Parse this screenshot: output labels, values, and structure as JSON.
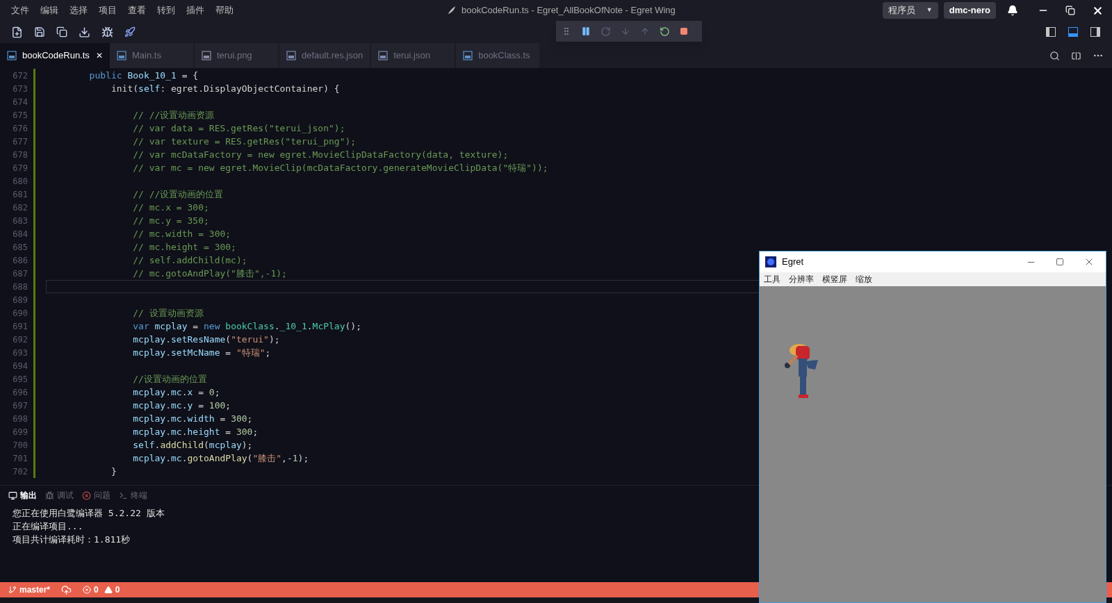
{
  "menu": [
    "文件",
    "编辑",
    "选择",
    "项目",
    "查看",
    "转到",
    "插件",
    "帮助"
  ],
  "window_title": "bookCodeRun.ts - Egret_AllBookOfNote - Egret Wing",
  "role_dropdown": {
    "value": "程序员",
    "arrow": "▼"
  },
  "user": "dmc-nero",
  "layout_toggles": [
    {
      "kind": "left",
      "selected": false
    },
    {
      "kind": "bottom",
      "selected": true
    },
    {
      "kind": "right",
      "selected": false
    }
  ],
  "tabs": [
    {
      "label": "bookCodeRun.ts",
      "kind": "ts",
      "selected": true,
      "close": "✕"
    },
    {
      "label": "Main.ts",
      "kind": "ts",
      "selected": false
    },
    {
      "label": "terui.png",
      "kind": "png",
      "selected": false
    },
    {
      "label": "default.res.json",
      "kind": "json",
      "selected": false
    },
    {
      "label": "terui.json",
      "kind": "json",
      "selected": false
    },
    {
      "label": "bookClass.ts",
      "kind": "ts",
      "selected": false
    }
  ],
  "code": [
    {
      "num": "672",
      "current": false,
      "tokens": [
        {
          "t": "        public ",
          "kind": "k"
        },
        {
          "t": "Book_10_1",
          "kind": "v"
        },
        {
          "t": " = {",
          "kind": "p"
        }
      ]
    },
    {
      "num": "673",
      "current": false,
      "tokens": [
        {
          "t": "            init(",
          "kind": "p"
        },
        {
          "t": "self",
          "kind": "v"
        },
        {
          "t": ": egret.DisplayObjectContainer) {",
          "kind": "p"
        }
      ]
    },
    {
      "num": "674",
      "current": false
    },
    {
      "num": "675",
      "current": false,
      "tokens": [
        {
          "t": "                // //设置动画资源",
          "kind": "c"
        }
      ]
    },
    {
      "num": "676",
      "current": false,
      "tokens": [
        {
          "t": "                // var data = RES.getRes(\"terui_json\");",
          "kind": "c"
        }
      ]
    },
    {
      "num": "677",
      "current": false,
      "tokens": [
        {
          "t": "                // var texture = RES.getRes(\"terui_png\");",
          "kind": "c"
        }
      ]
    },
    {
      "num": "678",
      "current": false,
      "tokens": [
        {
          "t": "                // var mcDataFactory = new egret.MovieClipDataFactory(data, texture);",
          "kind": "c"
        }
      ]
    },
    {
      "num": "679",
      "current": false,
      "tokens": [
        {
          "t": "                // var mc = new egret.MovieClip(mcDataFactory.generateMovieClipData(\"特瑞\"));",
          "kind": "c"
        }
      ]
    },
    {
      "num": "680",
      "current": false
    },
    {
      "num": "681",
      "current": false,
      "tokens": [
        {
          "t": "                // //设置动画的位置",
          "kind": "c"
        }
      ]
    },
    {
      "num": "682",
      "current": false,
      "tokens": [
        {
          "t": "                // mc.x = 300;",
          "kind": "c"
        }
      ]
    },
    {
      "num": "683",
      "current": false,
      "tokens": [
        {
          "t": "                // mc.y = 350;",
          "kind": "c"
        }
      ]
    },
    {
      "num": "684",
      "current": false,
      "tokens": [
        {
          "t": "                // mc.width = 300;",
          "kind": "c"
        }
      ]
    },
    {
      "num": "685",
      "current": false,
      "tokens": [
        {
          "t": "                // mc.height = 300;",
          "kind": "c"
        }
      ]
    },
    {
      "num": "686",
      "current": false,
      "tokens": [
        {
          "t": "                // self.addChild(mc);",
          "kind": "c"
        }
      ]
    },
    {
      "num": "687",
      "current": false,
      "tokens": [
        {
          "t": "                // mc.gotoAndPlay(\"膝击\",-1);",
          "kind": "c"
        }
      ]
    },
    {
      "num": "688",
      "current": true
    },
    {
      "num": "689",
      "current": false
    },
    {
      "num": "690",
      "current": false,
      "tokens": [
        {
          "t": "                // 设置动画资源",
          "kind": "c"
        }
      ]
    },
    {
      "num": "691",
      "current": false,
      "tokens": [
        {
          "t": "                var ",
          "kind": "k"
        },
        {
          "t": "mcplay",
          "kind": "v"
        },
        {
          "t": " = ",
          "kind": "p"
        },
        {
          "t": "new ",
          "kind": "k"
        },
        {
          "t": "bookClass",
          "kind": "t"
        },
        {
          "t": ".",
          "kind": "p"
        },
        {
          "t": "_10_1",
          "kind": "t"
        },
        {
          "t": ".",
          "kind": "p"
        },
        {
          "t": "McPlay",
          "kind": "t"
        },
        {
          "t": "();",
          "kind": "p"
        }
      ]
    },
    {
      "num": "692",
      "current": false,
      "tokens": [
        {
          "t": "                mcplay",
          "kind": "v"
        },
        {
          "t": ".",
          "kind": "p"
        },
        {
          "t": "setResName",
          "kind": "v"
        },
        {
          "t": "(",
          "kind": "p"
        },
        {
          "t": "\"terui\"",
          "kind": "s"
        },
        {
          "t": ");",
          "kind": "p"
        }
      ]
    },
    {
      "num": "693",
      "current": false,
      "tokens": [
        {
          "t": "                mcplay",
          "kind": "v"
        },
        {
          "t": ".",
          "kind": "p"
        },
        {
          "t": "setMcName",
          "kind": "v"
        },
        {
          "t": " = ",
          "kind": "p"
        },
        {
          "t": "\"特瑞\"",
          "kind": "s"
        },
        {
          "t": ";",
          "kind": "p"
        }
      ]
    },
    {
      "num": "694",
      "current": false
    },
    {
      "num": "695",
      "current": false,
      "tokens": [
        {
          "t": "                //设置动画的位置",
          "kind": "c"
        }
      ]
    },
    {
      "num": "696",
      "current": false,
      "tokens": [
        {
          "t": "                mcplay",
          "kind": "v"
        },
        {
          "t": ".",
          "kind": "p"
        },
        {
          "t": "mc",
          "kind": "v"
        },
        {
          "t": ".",
          "kind": "p"
        },
        {
          "t": "x",
          "kind": "v"
        },
        {
          "t": " = ",
          "kind": "p"
        },
        {
          "t": "0",
          "kind": "n"
        },
        {
          "t": ";",
          "kind": "p"
        }
      ]
    },
    {
      "num": "697",
      "current": false,
      "tokens": [
        {
          "t": "                mcplay",
          "kind": "v"
        },
        {
          "t": ".",
          "kind": "p"
        },
        {
          "t": "mc",
          "kind": "v"
        },
        {
          "t": ".",
          "kind": "p"
        },
        {
          "t": "y",
          "kind": "v"
        },
        {
          "t": " = ",
          "kind": "p"
        },
        {
          "t": "100",
          "kind": "n"
        },
        {
          "t": ";",
          "kind": "p"
        }
      ]
    },
    {
      "num": "698",
      "current": false,
      "tokens": [
        {
          "t": "                mcplay",
          "kind": "v"
        },
        {
          "t": ".",
          "kind": "p"
        },
        {
          "t": "mc",
          "kind": "v"
        },
        {
          "t": ".",
          "kind": "p"
        },
        {
          "t": "width",
          "kind": "v"
        },
        {
          "t": " = ",
          "kind": "p"
        },
        {
          "t": "300",
          "kind": "n"
        },
        {
          "t": ";",
          "kind": "p"
        }
      ]
    },
    {
      "num": "699",
      "current": false,
      "tokens": [
        {
          "t": "                mcplay",
          "kind": "v"
        },
        {
          "t": ".",
          "kind": "p"
        },
        {
          "t": "mc",
          "kind": "v"
        },
        {
          "t": ".",
          "kind": "p"
        },
        {
          "t": "height",
          "kind": "v"
        },
        {
          "t": " = ",
          "kind": "p"
        },
        {
          "t": "300",
          "kind": "n"
        },
        {
          "t": ";",
          "kind": "p"
        }
      ]
    },
    {
      "num": "700",
      "current": false,
      "tokens": [
        {
          "t": "                self",
          "kind": "v"
        },
        {
          "t": ".",
          "kind": "p"
        },
        {
          "t": "addChild",
          "kind": "f"
        },
        {
          "t": "(",
          "kind": "p"
        },
        {
          "t": "mcplay",
          "kind": "v"
        },
        {
          "t": ");",
          "kind": "p"
        }
      ]
    },
    {
      "num": "701",
      "current": false,
      "tokens": [
        {
          "t": "                mcplay",
          "kind": "v"
        },
        {
          "t": ".",
          "kind": "p"
        },
        {
          "t": "mc",
          "kind": "v"
        },
        {
          "t": ".",
          "kind": "p"
        },
        {
          "t": "gotoAndPlay",
          "kind": "f"
        },
        {
          "t": "(",
          "kind": "p"
        },
        {
          "t": "\"膝击\"",
          "kind": "s"
        },
        {
          "t": ",-",
          "kind": "p"
        },
        {
          "t": "1",
          "kind": "n"
        },
        {
          "t": ");",
          "kind": "p"
        }
      ]
    },
    {
      "num": "702",
      "current": false,
      "tokens": [
        {
          "t": "            }",
          "kind": "p"
        }
      ]
    }
  ],
  "panel_tabs": [
    {
      "label": "输出",
      "kind": "output",
      "selected": true
    },
    {
      "label": "调试",
      "kind": "debug",
      "selected": false
    },
    {
      "label": "问题",
      "kind": "problems",
      "selected": false
    },
    {
      "label": "终端",
      "kind": "terminal",
      "selected": false
    }
  ],
  "output": [
    "您正在使用白鹭编译器 5.2.22 版本",
    "正在编译项目...",
    "项目共计编译耗时：1.811秒"
  ],
  "status_bar": {
    "branch": "master*",
    "errors": "0",
    "warnings": "0"
  },
  "preview_window": {
    "title": "Egret",
    "menu": [
      "工具",
      "分辨率",
      "横竖屏",
      "缩放"
    ]
  }
}
